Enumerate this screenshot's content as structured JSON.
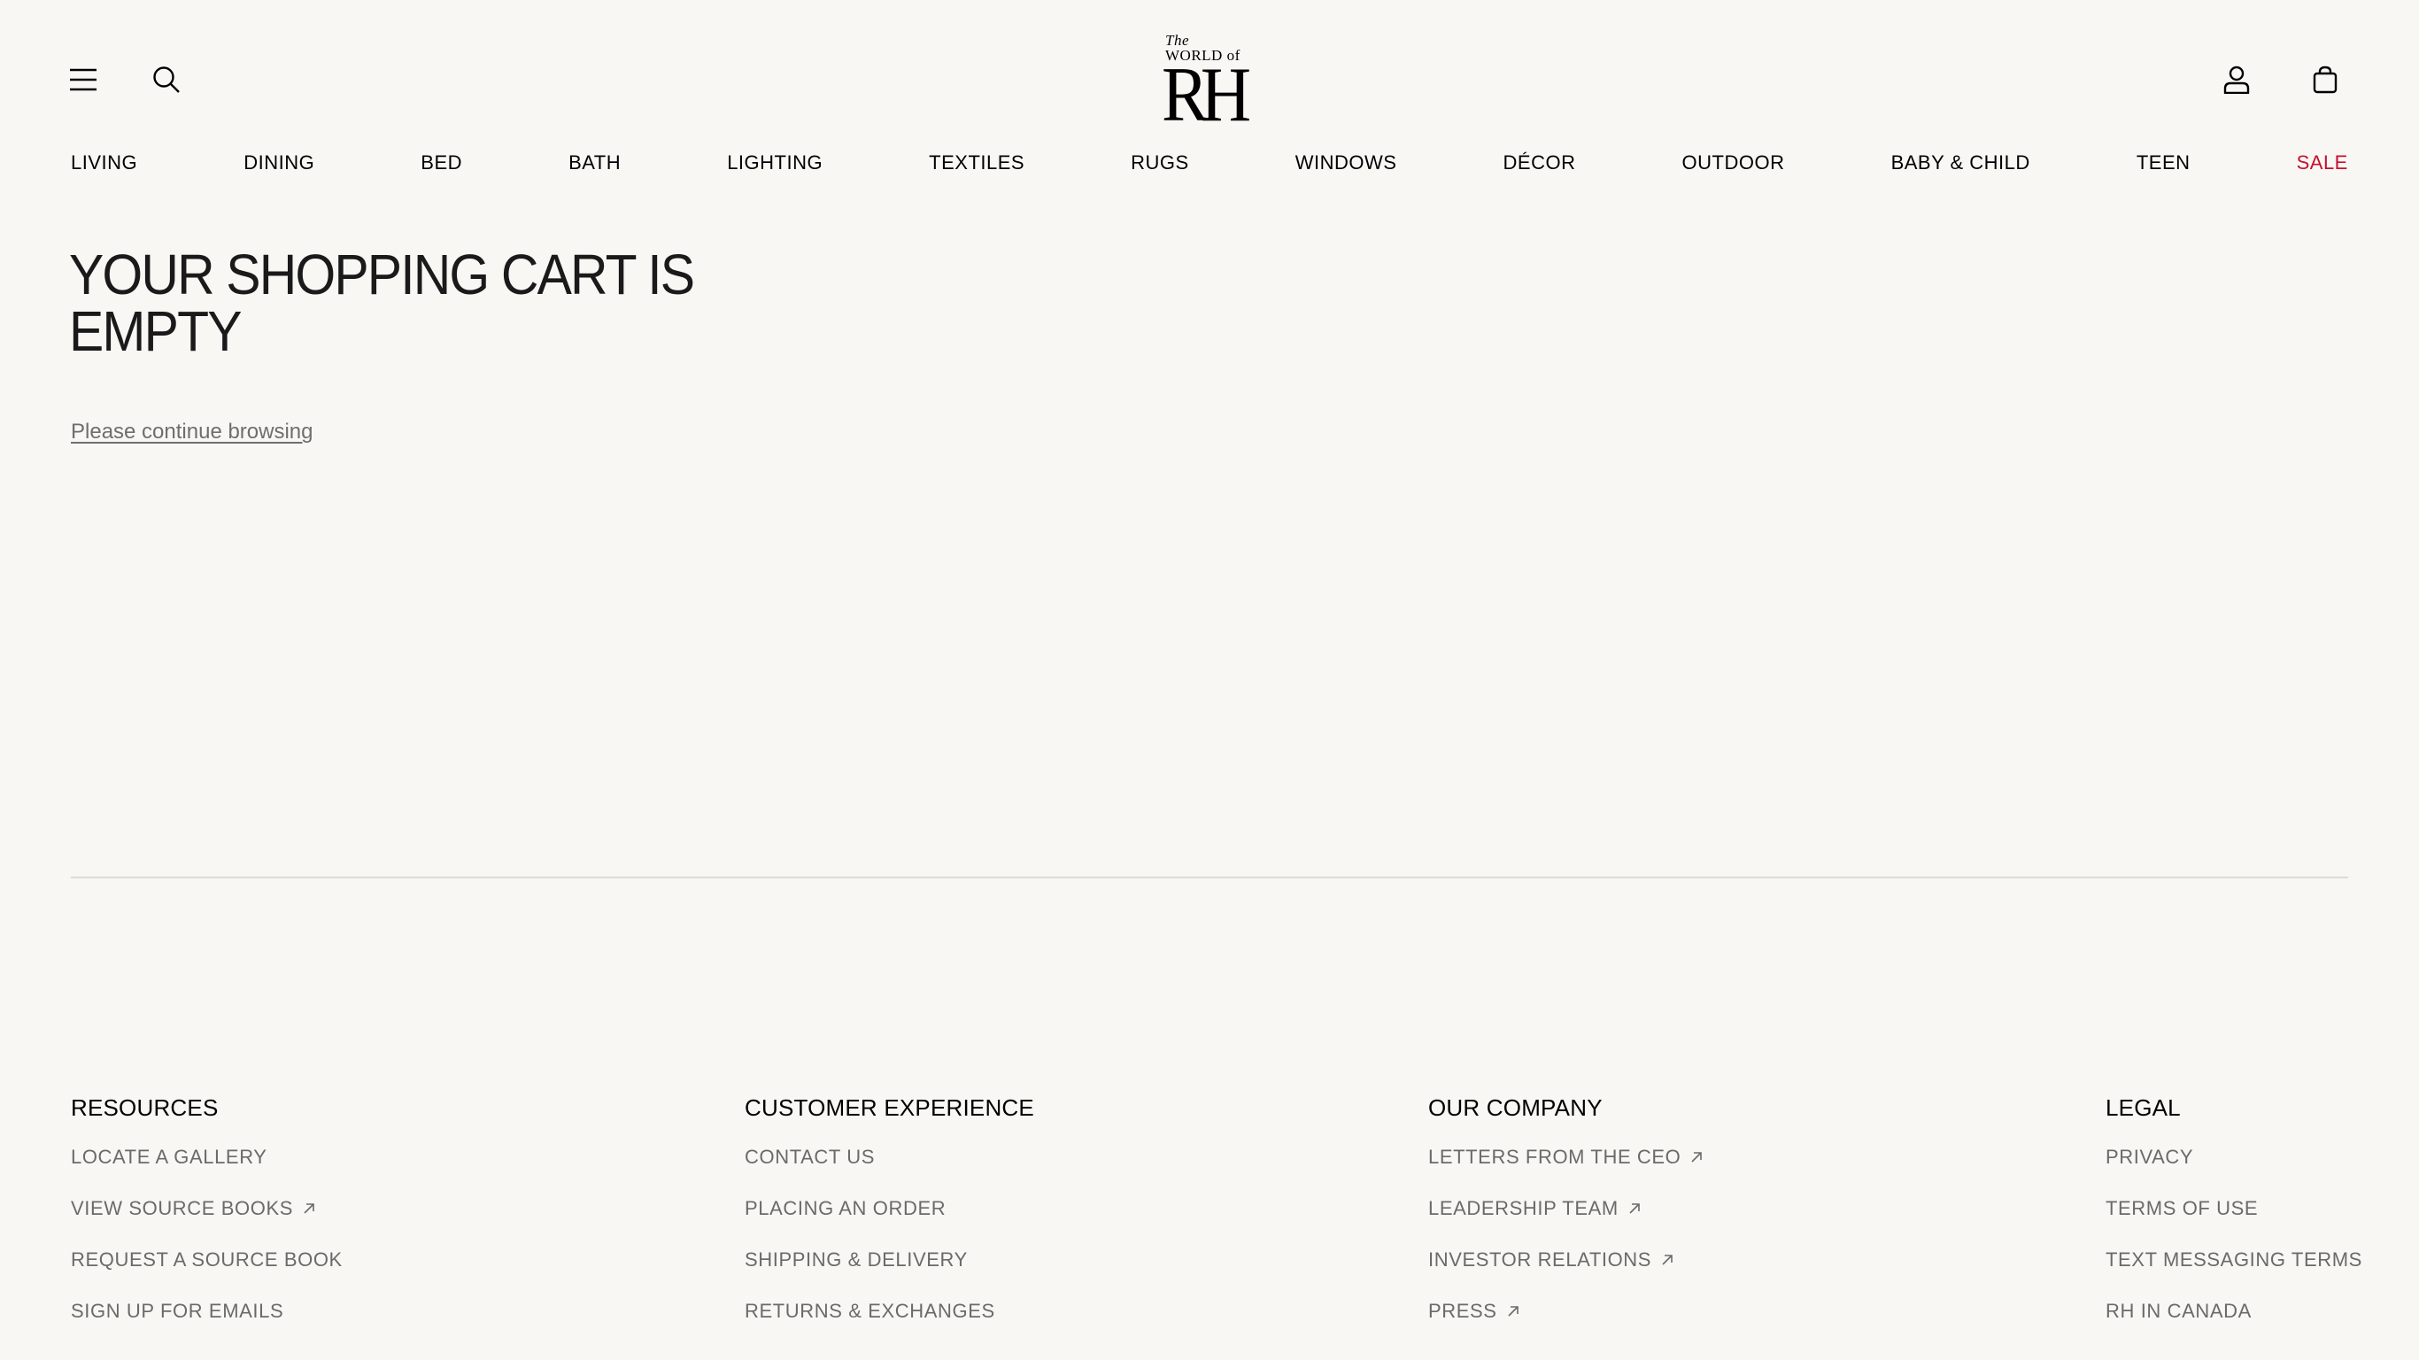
{
  "header": {
    "logo": {
      "line1": "The",
      "line2": "WORLD of",
      "mark": "RH"
    },
    "icons": {
      "menu": "hamburger-icon",
      "search": "search-icon",
      "account": "user-icon",
      "cart": "shopping-bag-icon"
    }
  },
  "nav": {
    "items": [
      {
        "label": "LIVING"
      },
      {
        "label": "DINING"
      },
      {
        "label": "BED"
      },
      {
        "label": "BATH"
      },
      {
        "label": "LIGHTING"
      },
      {
        "label": "TEXTILES"
      },
      {
        "label": "RUGS"
      },
      {
        "label": "WINDOWS"
      },
      {
        "label": "DÉCOR"
      },
      {
        "label": "OUTDOOR"
      },
      {
        "label": "BABY & CHILD"
      },
      {
        "label": "TEEN"
      },
      {
        "label": "SALE"
      }
    ],
    "sale_color": "#c8102e"
  },
  "main": {
    "title_line1": "YOUR SHOPPING CART IS",
    "title_line2": "EMPTY",
    "continue_link": "Please continue browsing"
  },
  "footer": {
    "resources": {
      "heading": "RESOURCES",
      "links": [
        "LOCATE A GALLERY",
        "VIEW SOURCE BOOKS",
        "REQUEST A SOURCE BOOK",
        "SIGN UP FOR EMAILS"
      ]
    },
    "customer_experience": {
      "heading": "CUSTOMER EXPERIENCE",
      "links": [
        "CONTACT US",
        "PLACING AN ORDER",
        "SHIPPING & DELIVERY",
        "RETURNS & EXCHANGES"
      ]
    },
    "our_company": {
      "heading": "OUR COMPANY",
      "links": [
        "LETTERS FROM THE CEO",
        "LEADERSHIP TEAM",
        "INVESTOR RELATIONS",
        "PRESS"
      ]
    },
    "legal": {
      "heading": "LEGAL",
      "links": [
        "PRIVACY",
        "TERMS OF USE",
        "TEXT MESSAGING TERMS",
        "RH IN CANADA"
      ]
    }
  },
  "colors": {
    "background": "#f8f7f4",
    "link_gray": "#6a6a6a",
    "accent_sale": "#c8102e"
  }
}
